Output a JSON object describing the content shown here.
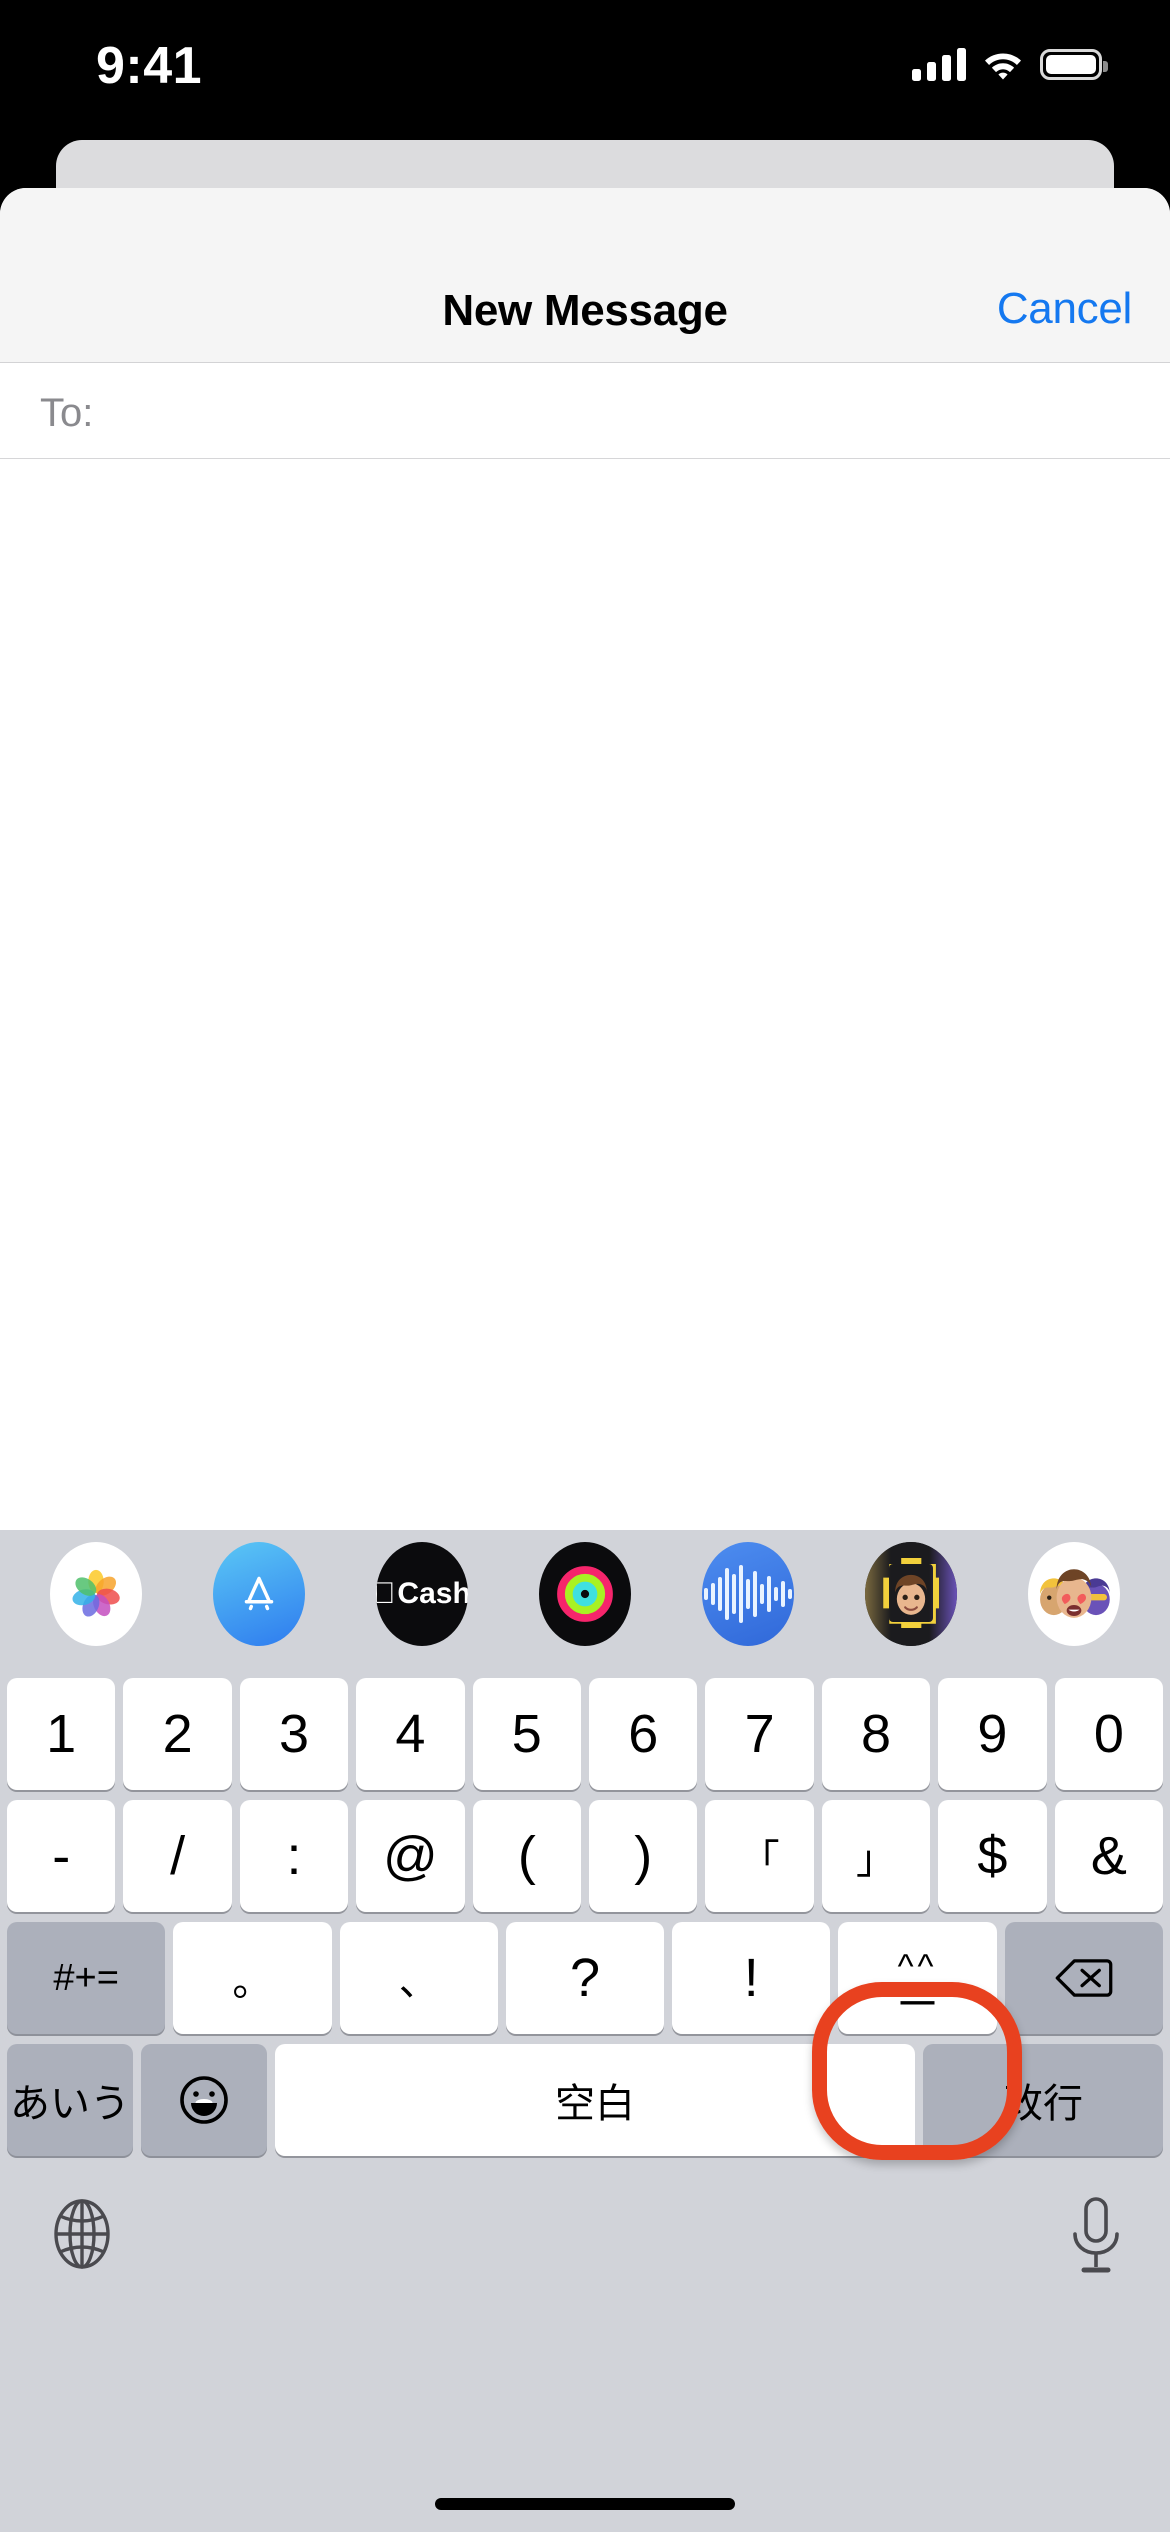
{
  "status_bar": {
    "time": "9:41",
    "signal_icon": "cellular-signal-icon",
    "wifi_icon": "wifi-icon",
    "battery_icon": "battery-icon"
  },
  "nav": {
    "title": "New Message",
    "cancel_label": "Cancel",
    "accent_color": "#1478F0"
  },
  "recipient_field": {
    "label": "To:",
    "value": "",
    "placeholder": ""
  },
  "toolbar": {
    "camera_icon": "camera-icon",
    "apps_icon": "app-store-icon",
    "message_input_value": "",
    "message_input_placeholder": "",
    "dictation_icon": "microphone-icon"
  },
  "app_strip": {
    "items": [
      {
        "name": "photos",
        "label": "Photos"
      },
      {
        "name": "app-store",
        "label": "App Store"
      },
      {
        "name": "apple-cash",
        "label": "Cash"
      },
      {
        "name": "fitness",
        "label": "Activity"
      },
      {
        "name": "audio-message",
        "label": "Audio"
      },
      {
        "name": "memoji",
        "label": "Memoji"
      },
      {
        "name": "memoji-stickers",
        "label": "Memoji Stickers"
      }
    ]
  },
  "keyboard": {
    "language": "Japanese Romaji - numbers & symbols",
    "background_color": "#D1D3D9",
    "row1": [
      "1",
      "2",
      "3",
      "4",
      "5",
      "6",
      "7",
      "8",
      "9",
      "0"
    ],
    "row2": [
      "-",
      "/",
      ":",
      "@",
      "(",
      ")",
      "「",
      "」",
      "$",
      "&"
    ],
    "row3": [
      {
        "label": "#+=",
        "type": "modifier",
        "name": "symbols-shift-key"
      },
      {
        "label": "。",
        "type": "char",
        "name": "ideographic-full-stop-key"
      },
      {
        "label": "、",
        "type": "char",
        "name": "ideographic-comma-key"
      },
      {
        "label": "?",
        "type": "char",
        "name": "question-mark-key"
      },
      {
        "label": "!",
        "type": "char",
        "name": "exclamation-mark-key"
      },
      {
        "label": "^^",
        "label_bottom": "—",
        "type": "char",
        "name": "kaomoji-key",
        "highlighted": true
      },
      {
        "label": "delete",
        "type": "modifier",
        "name": "delete-key"
      }
    ],
    "row4": [
      {
        "label": "あいう",
        "type": "modifier",
        "name": "kana-switch-key"
      },
      {
        "label": "emoji",
        "type": "modifier",
        "name": "emoji-key"
      },
      {
        "label": "空白",
        "type": "space",
        "name": "space-key"
      },
      {
        "label": "改行",
        "type": "modifier",
        "name": "return-key"
      }
    ],
    "bottom": {
      "globe_icon": "globe-icon",
      "dictation_icon": "microphone-icon"
    }
  },
  "annotation": {
    "target": "kaomoji-key",
    "color": "#E8411F",
    "shape": "rounded-rect-outline"
  }
}
